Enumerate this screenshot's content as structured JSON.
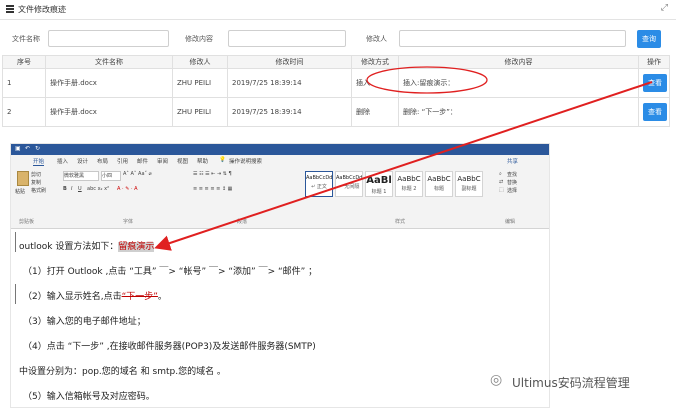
{
  "header": {
    "title": "文件修改痕迹",
    "expand_icon": "expand-icon"
  },
  "search": {
    "filename_label": "文件名称",
    "content_label": "修改内容",
    "person_label": "修改人",
    "button": "查询"
  },
  "table": {
    "columns": [
      "序号",
      "文件名称",
      "修改人",
      "修改时间",
      "修改方式",
      "修改内容",
      "操作"
    ],
    "rows": [
      {
        "index": "1",
        "file": "操作手册.docx",
        "person": "ZHU PEILI",
        "time": "2019/7/25 18:39:14",
        "mode": "插入",
        "content": "插入:留痕演示：",
        "action": "查看"
      },
      {
        "index": "2",
        "file": "操作手册.docx",
        "person": "ZHU PEILI",
        "time": "2019/7/25 18:39:14",
        "mode": "删除",
        "content": "删除: “下一步”：",
        "action": "查看"
      }
    ]
  },
  "word": {
    "tabs": [
      "开始",
      "插入",
      "设计",
      "布局",
      "引用",
      "邮件",
      "审阅",
      "视图",
      "帮助"
    ],
    "tell_me": "操作说明搜索",
    "share": "共享",
    "ribbon": {
      "paste": "粘贴",
      "cut": "剪切",
      "copy": "复制",
      "format_painter": "格式刷",
      "clipboard": "剪贴板",
      "font_name": "微软雅黑",
      "font_size": "小四",
      "font_group": "字体",
      "paragraph_group": "段落",
      "styles_group": "样式",
      "editing_group": "编辑",
      "find": "查找",
      "replace": "替换",
      "select": "选择"
    },
    "styles": [
      {
        "sample": "AaBbCcDd",
        "name": "↵ 正文"
      },
      {
        "sample": "AaBbCcDd",
        "name": "↵ 无间隔"
      },
      {
        "sample": "AaBl",
        "name": "标题 1"
      },
      {
        "sample": "AaBbC",
        "name": "标题 2"
      },
      {
        "sample": "AaBbC",
        "name": "标题"
      },
      {
        "sample": "AaBbC",
        "name": "副标题"
      }
    ],
    "doc": {
      "line1_prefix": "outlook 设置方法如下：",
      "line1_insert": "留痕演示",
      "line2": "（1）打开 Outlook ,点击 “工具” ￣> “帐号” ￣> “添加” ￣> “邮件” ；",
      "line3_prefix": "（2）输入显示姓名,点击",
      "line3_deleted": "“下一步”",
      "line3_suffix": "。",
      "line4": "（3）输入您的电子邮件地址；",
      "line5": "（4）点击 “下一步” ,在接收邮件服务器(POP3)及发送邮件服务器(SMTP)",
      "line6": "中设置分别为：pop.您的域名 和 smtp.您的域名 。",
      "line7": "（5）输入信箱帐号及对应密码。"
    }
  },
  "watermark": {
    "text": "Ultimus安码流程管理"
  },
  "colors": {
    "primary": "#2b8ce6",
    "word_blue": "#2b579a",
    "annotation_red": "#e02020"
  }
}
